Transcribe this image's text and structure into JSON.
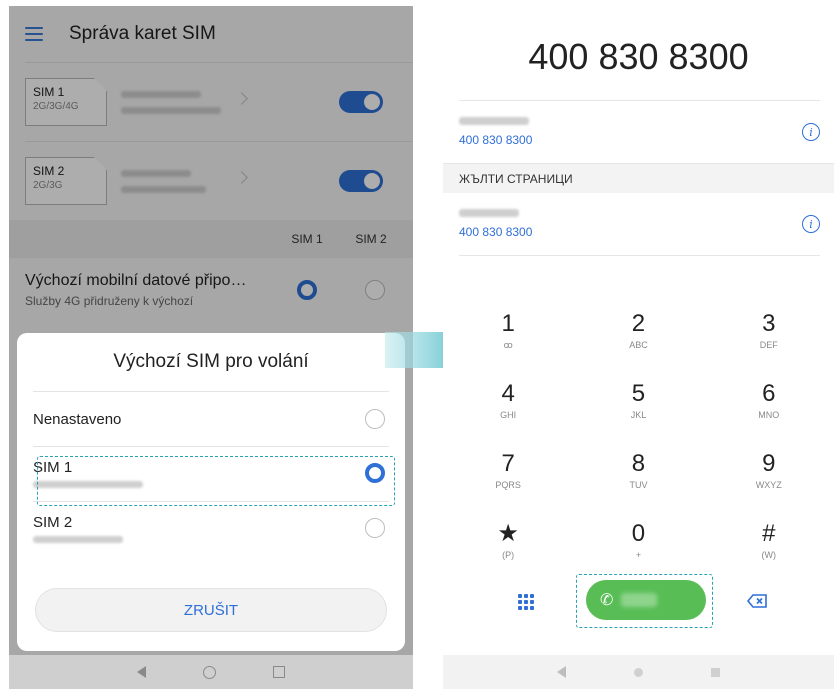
{
  "left": {
    "header": {
      "title": "Správa karet SIM"
    },
    "sims": [
      {
        "slot": "SIM 1",
        "network": "2G/3G/4G",
        "enabled": true
      },
      {
        "slot": "SIM 2",
        "network": "2G/3G",
        "enabled": true
      }
    ],
    "columns": {
      "sim1": "SIM 1",
      "sim2": "SIM 2"
    },
    "data_pref": {
      "title": "Výchozí mobilní datové připo…",
      "subtitle": "Služby 4G přidruženy k výchozí",
      "selected": "SIM 1"
    },
    "dialog": {
      "title": "Výchozí SIM pro volání",
      "options": [
        {
          "label": "Nenastaveno",
          "selected": false
        },
        {
          "label": "SIM 1",
          "selected": true
        },
        {
          "label": "SIM 2",
          "selected": false
        }
      ],
      "cancel_label": "ZRUŠIT"
    }
  },
  "right": {
    "number": "400 830 8300",
    "results": [
      {
        "number": "400 830 8300"
      },
      {
        "number": "400 830 8300"
      }
    ],
    "section_label": "ЖЪЛТИ СТРАНИЦИ",
    "keys": [
      {
        "digit": "1",
        "letters": "ꝏ"
      },
      {
        "digit": "2",
        "letters": "ABC"
      },
      {
        "digit": "3",
        "letters": "DEF"
      },
      {
        "digit": "4",
        "letters": "GHI"
      },
      {
        "digit": "5",
        "letters": "JKL"
      },
      {
        "digit": "6",
        "letters": "MNO"
      },
      {
        "digit": "7",
        "letters": "PQRS"
      },
      {
        "digit": "8",
        "letters": "TUV"
      },
      {
        "digit": "9",
        "letters": "WXYZ"
      },
      {
        "digit": "★",
        "letters": "(P)"
      },
      {
        "digit": "0",
        "letters": "+"
      },
      {
        "digit": "#",
        "letters": "(W)"
      }
    ]
  },
  "colors": {
    "accent": "#2f6fd6",
    "call_green": "#59bd56",
    "highlight": "#29a3b3"
  },
  "icons": [
    "menu-icon",
    "chevron-right-icon",
    "info-icon",
    "dialpad-icon",
    "phone-icon",
    "backspace-icon",
    "back-icon",
    "home-icon",
    "recent-apps-icon"
  ]
}
